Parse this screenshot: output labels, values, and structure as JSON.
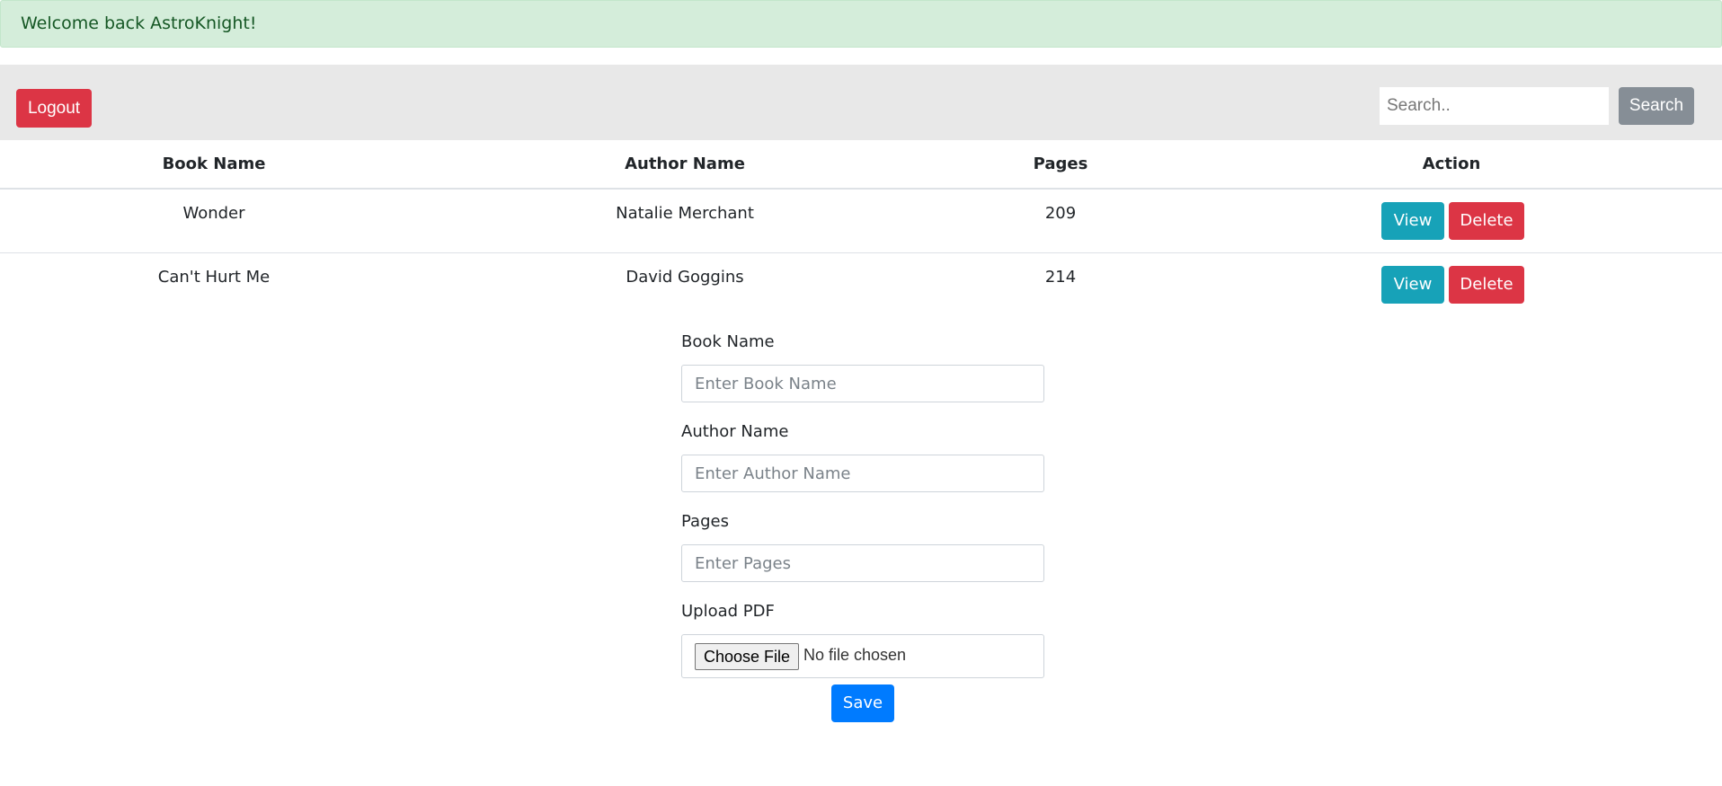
{
  "alert": {
    "message": "Welcome back AstroKnight!"
  },
  "toolbar": {
    "logout_label": "Logout",
    "search_placeholder": "Search..",
    "search_label": "Search"
  },
  "table": {
    "headers": [
      "Book Name",
      "Author Name",
      "Pages",
      "Action"
    ],
    "rows": [
      {
        "book": "Wonder",
        "author": "Natalie Merchant",
        "pages": "209",
        "view_label": "View",
        "delete_label": "Delete"
      },
      {
        "book": "Can't Hurt Me",
        "author": "David Goggins",
        "pages": "214",
        "view_label": "View",
        "delete_label": "Delete"
      }
    ]
  },
  "form": {
    "book_label": "Book Name",
    "book_placeholder": "Enter Book Name",
    "author_label": "Author Name",
    "author_placeholder": "Enter Author Name",
    "pages_label": "Pages",
    "pages_placeholder": "Enter Pages",
    "upload_label": "Upload PDF",
    "choose_file_label": "Choose File",
    "file_status": "No file chosen",
    "save_label": "Save"
  },
  "colors": {
    "alert_bg": "#d4edda",
    "danger": "#dc3545",
    "info": "#17a2b8",
    "primary": "#007bff",
    "secondary": "#868e96"
  }
}
